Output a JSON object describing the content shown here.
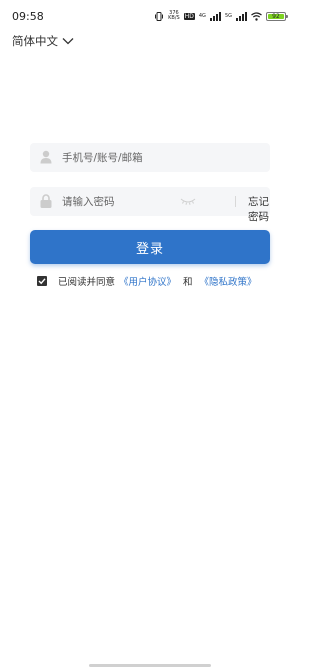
{
  "status_bar": {
    "time": "09:58",
    "net_speed_top": "376",
    "net_speed_bottom": "KB/S",
    "hd_label": "HD",
    "net_4g": "4G",
    "net_5g": "5G",
    "battery_level": "92",
    "battery_color": "#7ed321"
  },
  "language": {
    "selected": "简体中文",
    "icon": "chevron-down-icon"
  },
  "form": {
    "username_placeholder": "手机号/账号/邮箱",
    "username_value": "",
    "username_icon": "user-icon",
    "password_placeholder": "请输入密码",
    "password_value": "",
    "password_icon": "lock-icon",
    "visibility_icon": "eye-closed-icon",
    "forgot_label": "忘记密码"
  },
  "login_button": {
    "label": "登录",
    "color": "#2f74c9"
  },
  "agreement": {
    "checked": true,
    "prefix": "已阅读并同意",
    "user_agreement": "《用户协议》",
    "and": "和",
    "privacy_policy": "《隐私政策》",
    "link_color": "#2f74c9"
  }
}
